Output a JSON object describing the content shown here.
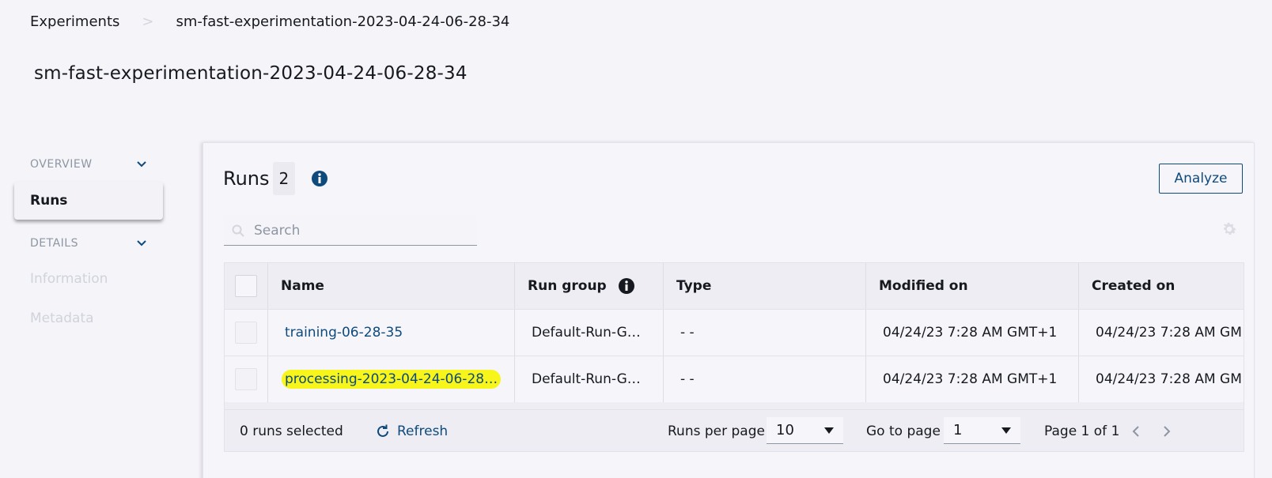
{
  "breadcrumb": {
    "items": [
      "Experiments",
      "sm-fast-experimentation-2023-04-24-06-28-34"
    ],
    "separator": ">"
  },
  "page_title": "sm-fast-experimentation-2023-04-24-06-28-34",
  "sidebar": {
    "overview_label": "OVERVIEW",
    "runs_label": "Runs",
    "details_label": "DETAILS",
    "information_label": "Information",
    "metadata_label": "Metadata"
  },
  "runs_panel": {
    "title": "Runs",
    "count": "2",
    "analyze_label": "Analyze",
    "search_placeholder": "Search"
  },
  "table": {
    "columns": [
      "Name",
      "Run group",
      "Type",
      "Modified on",
      "Created on"
    ],
    "rows": [
      {
        "name": "training-06-28-35",
        "run_group": "Default-Run-G…",
        "type": "- -",
        "modified_on": "04/24/23 7:28 AM GMT+1",
        "created_on": "04/24/23 7:28 AM GM"
      },
      {
        "name": "processing-2023-04-24-06-28…",
        "run_group": "Default-Run-G…",
        "type": "- -",
        "modified_on": "04/24/23 7:28 AM GMT+1",
        "created_on": "04/24/23 7:28 AM GM"
      }
    ]
  },
  "footer": {
    "selected_text": "0 runs selected",
    "refresh_label": "Refresh",
    "runs_per_page_label": "Runs per page",
    "runs_per_page_value": "10",
    "go_to_page_label": "Go to page",
    "go_to_page_value": "1",
    "page_status": "Page 1 of 1"
  },
  "colors": {
    "background": "#f5f4f9",
    "link": "#0f4a7c",
    "highlight": "#f7f51a",
    "muted_text": "#8d96a3"
  },
  "icons": [
    "chevron-down-icon",
    "info-icon",
    "search-icon",
    "settings-icon",
    "refresh-icon",
    "caret-down-icon",
    "chevron-left-icon",
    "chevron-right-icon"
  ]
}
